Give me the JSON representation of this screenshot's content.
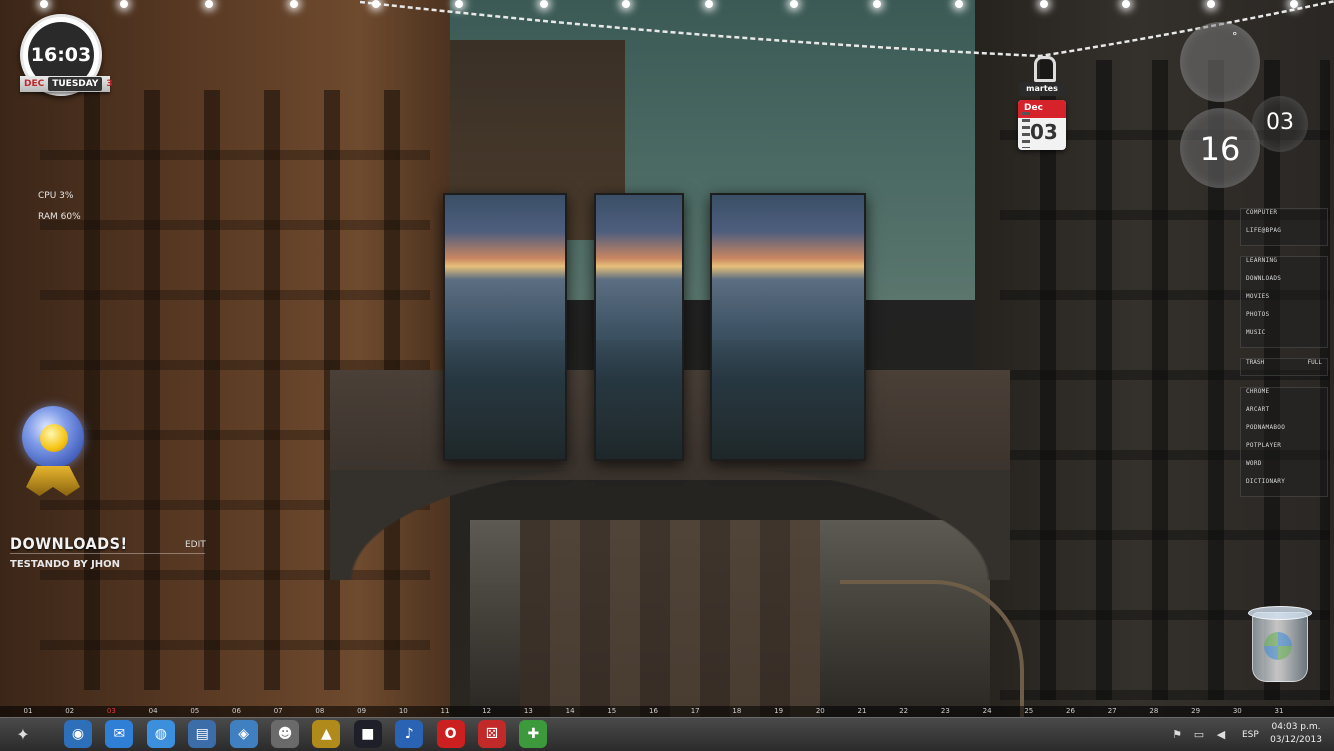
{
  "clock": {
    "time": "16:03",
    "month_abbr": "DEC",
    "weekday": "TUESDAY",
    "day": "3"
  },
  "stats": {
    "cpu": "CPU 3%",
    "ram": "RAM 60%"
  },
  "downloads": {
    "title": "DOWNLOADS!",
    "edit": "EDIT",
    "subtitle": "TESTANDO BY JHON"
  },
  "calendar": {
    "weekday": "martes",
    "month": "Dec",
    "day": "03"
  },
  "bubble_clock": {
    "seconds_symbol": "°",
    "hour": "16",
    "minute": "03"
  },
  "launcher": {
    "group1": [
      "COMPUTER",
      "LIFE@BPAG"
    ],
    "group2": [
      "LEARNING",
      "DOWNLOADS",
      "MOVIES",
      "PHOTOS",
      "MUSIC"
    ],
    "trash": {
      "label": "TRASH",
      "status": "FULL"
    },
    "group4": [
      "CHROME",
      "ARCART",
      "PODNAMABOO",
      "POTPLAYER",
      "WORD",
      "DICTIONARY"
    ]
  },
  "day_strip": {
    "days": [
      "01",
      "02",
      "03",
      "04",
      "05",
      "06",
      "07",
      "08",
      "09",
      "10",
      "11",
      "12",
      "13",
      "14",
      "15",
      "16",
      "17",
      "18",
      "19",
      "20",
      "21",
      "22",
      "23",
      "24",
      "25",
      "26",
      "27",
      "28",
      "29",
      "30",
      "31"
    ],
    "today_index": 2
  },
  "taskbar": {
    "apps": [
      {
        "name": "media-player",
        "glyph": "◉",
        "color": "#2d6fb8"
      },
      {
        "name": "messenger",
        "glyph": "✉",
        "color": "#2f7fd6"
      },
      {
        "name": "globe",
        "glyph": "◍",
        "color": "#3b8fdc"
      },
      {
        "name": "document",
        "glyph": "▤",
        "color": "#3d6da8"
      },
      {
        "name": "remote",
        "glyph": "◈",
        "color": "#4080c0"
      },
      {
        "name": "user",
        "glyph": "☻",
        "color": "#6a6a6a"
      },
      {
        "name": "archive",
        "glyph": "▲",
        "color": "#b08a1a"
      },
      {
        "name": "terminal",
        "glyph": "■",
        "color": "#1f1f2a"
      },
      {
        "name": "music",
        "glyph": "♪",
        "color": "#2a63b4"
      },
      {
        "name": "opera",
        "glyph": "O",
        "color": "#cc1f1f"
      },
      {
        "name": "dice",
        "glyph": "⚄",
        "color": "#c22a2a"
      },
      {
        "name": "network",
        "glyph": "✚",
        "color": "#3c9a3c"
      }
    ],
    "tray": {
      "language": "ESP",
      "time": "04:03 p.m.",
      "date": "03/12/2013"
    }
  }
}
